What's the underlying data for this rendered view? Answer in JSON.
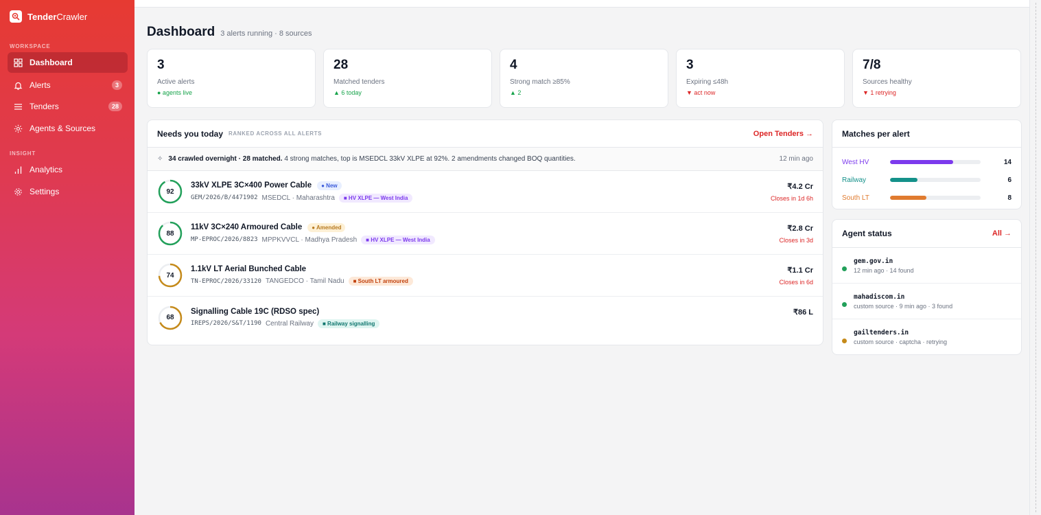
{
  "brand": {
    "name_bold": "Tender",
    "name_light": "Crawler",
    "accent": "#e63a32"
  },
  "sidebar": {
    "workspace_label": "WORKSPACE",
    "insight_label": "INSIGHT",
    "items": [
      {
        "label": "Dashboard",
        "icon": "grid-icon",
        "active": true
      },
      {
        "label": "Alerts",
        "icon": "bell-icon",
        "badge": "3"
      },
      {
        "label": "Tenders",
        "icon": "list-icon",
        "badge": "28"
      },
      {
        "label": "Agents & Sources",
        "icon": "sun-icon"
      },
      {
        "label": "Analytics",
        "icon": "bar-chart-icon"
      },
      {
        "label": "Settings",
        "icon": "gear-icon"
      }
    ]
  },
  "header": {
    "title": "Dashboard",
    "subtitle": "3 alerts running · 8 sources"
  },
  "stats": [
    {
      "value": "3",
      "label": "Active alerts",
      "delta": "● agents live",
      "tone": "green"
    },
    {
      "value": "28",
      "label": "Matched tenders",
      "delta": "▲ 6 today",
      "tone": "green"
    },
    {
      "value": "4",
      "label": "Strong match ≥85%",
      "delta": "▲ 2",
      "tone": "green"
    },
    {
      "value": "3",
      "label": "Expiring ≤48h",
      "delta": "▼ act now",
      "tone": "red"
    },
    {
      "value": "7/8",
      "label": "Sources healthy",
      "delta": "▼ 1 retrying",
      "tone": "red"
    }
  ],
  "needs": {
    "title": "Needs you today",
    "kicker": "RANKED ACROSS ALL ALERTS",
    "link": "Open Tenders →",
    "summary_bold": "34 crawled overnight · 28 matched.",
    "summary_text": "4 strong matches, top is MSEDCL 33kV XLPE at 92%. 2 amendments changed BOQ quantities.",
    "summary_time": "12 min ago",
    "rows": [
      {
        "score": "92",
        "score_value": 92,
        "color": "#22a05a",
        "title": "33kV XLPE 3C×400 Power Cable",
        "status": "● New",
        "ref": "GEM/2026/B/4471902",
        "buyer": "MSEDCL · Maharashtra",
        "tag": "■ HV XLPE — West India",
        "value": "₹4.2 Cr",
        "closes": "Closes in 1d 6h"
      },
      {
        "score": "88",
        "score_value": 88,
        "color": "#22a05a",
        "title": "11kV 3C×240 Armoured Cable",
        "status": "● Amended",
        "ref": "MP-EPROC/2026/8823",
        "buyer": "MPPKVVCL · Madhya Pradesh",
        "tag": "■ HV XLPE — West India",
        "value": "₹2.8 Cr",
        "closes": "Closes in 3d"
      },
      {
        "score": "74",
        "score_value": 74,
        "color": "#c58a1a",
        "title": "1.1kV LT Aerial Bunched Cable",
        "status": "",
        "ref": "TN-EPROC/2026/33120",
        "buyer": "TANGEDCO · Tamil Nadu",
        "tag": "■ South LT armoured",
        "value": "₹1.1 Cr",
        "closes": "Closes in 6d"
      },
      {
        "score": "68",
        "score_value": 68,
        "color": "#c58a1a",
        "title": "Signalling Cable 19C (RDSO spec)",
        "status": "",
        "ref": "IREPS/2026/S&T/1190",
        "buyer": "Central Railway",
        "tag": "■ Railway signalling",
        "value": "₹86 L",
        "closes": ""
      }
    ]
  },
  "matches": {
    "title": "Matches per alert",
    "rows": [
      {
        "label": "West HV",
        "count": "14",
        "fraction": 0.7,
        "color": "#7c3aed"
      },
      {
        "label": "Railway",
        "count": "6",
        "fraction": 0.3,
        "color": "#14918a"
      },
      {
        "label": "South LT",
        "count": "8",
        "fraction": 0.4,
        "color": "#e07b2f"
      }
    ]
  },
  "agents": {
    "title": "Agent status",
    "link": "All →",
    "rows": [
      {
        "name": "gem.gov.in",
        "sub": "12 min ago · 14 found",
        "color": "#22a05a"
      },
      {
        "name": "mahadiscom.in",
        "sub": "custom source · 9 min ago · 3 found",
        "color": "#22a05a"
      },
      {
        "name": "gailtenders.in",
        "sub": "custom source · captcha · retrying",
        "color": "#c58a1a"
      }
    ]
  }
}
